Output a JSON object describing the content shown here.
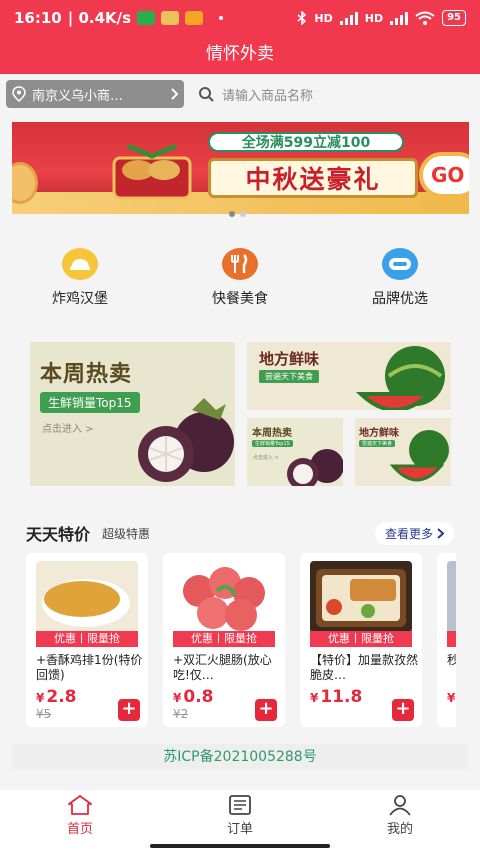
{
  "status_bar": {
    "time": "16:10",
    "speed": "| 0.4K/s",
    "network_1": "HD",
    "network_2": "HD",
    "battery": "95",
    "app_colors": [
      "#27b04a",
      "#eac15a",
      "#f5a623"
    ]
  },
  "header": {
    "title": "情怀外卖"
  },
  "location": {
    "label": "南京义乌小商…"
  },
  "search": {
    "placeholder": "请输入商品名称"
  },
  "banner": {
    "top_text": "全场满599立减100",
    "main_text": "中秋送豪礼",
    "go_text": "GO",
    "slide_count": 2,
    "active_slide": 1
  },
  "categories": [
    {
      "label": "炸鸡汉堡",
      "icon": "fried-chicken-icon",
      "color": "#f5c63a"
    },
    {
      "label": "快餐美食",
      "icon": "fork-knife-icon",
      "color": "#e8702c"
    },
    {
      "label": "品牌优选",
      "icon": "brand-icon",
      "color": "#3aa0e8"
    }
  ],
  "promos": {
    "weekly_hot": {
      "title": "本周热卖",
      "tag": "生鲜销量Top15",
      "link": "点击进入 >"
    },
    "local_fresh": {
      "title": "地方鲜味",
      "tag": "尝遍天下美食"
    },
    "small_weekly_hot": {
      "title": "本周热卖",
      "tag": "生鲜销量Top15",
      "link": "点击进入 >"
    },
    "small_local_fresh": {
      "title": "地方鲜味",
      "tag": "尝遍天下美食"
    }
  },
  "deals_section": {
    "title": "天天特价",
    "subtitle": "超级特惠",
    "more": "查看更多"
  },
  "deals": [
    {
      "tag": "优惠丨限量抢",
      "name": "+香酥鸡排1份(特价回馈)",
      "currency": "¥",
      "price": "2.8",
      "old_price": "¥5"
    },
    {
      "tag": "优惠丨限量抢",
      "name": "+双汇火腿肠(放心吃!仅…",
      "currency": "¥",
      "price": "0.8",
      "old_price": "¥2"
    },
    {
      "tag": "优惠丨限量抢",
      "name": "【特价】加量款孜然脆皮…",
      "currency": "¥",
      "price": "11.8",
      "old_price": ""
    },
    {
      "tag": "优",
      "name": "秒",
      "currency": "¥",
      "price": "",
      "old_price": ""
    }
  ],
  "icp": {
    "text": "苏ICP备2021005288号"
  },
  "nav": [
    {
      "label": "首页",
      "icon": "home-icon",
      "active": true
    },
    {
      "label": "订单",
      "icon": "orders-icon",
      "active": false
    },
    {
      "label": "我的",
      "icon": "profile-icon",
      "active": false
    }
  ],
  "colors": {
    "brand": "#f0394f",
    "price": "#e5283a",
    "icp_text": "#2e9a6e",
    "link": "#2a3a8a"
  }
}
